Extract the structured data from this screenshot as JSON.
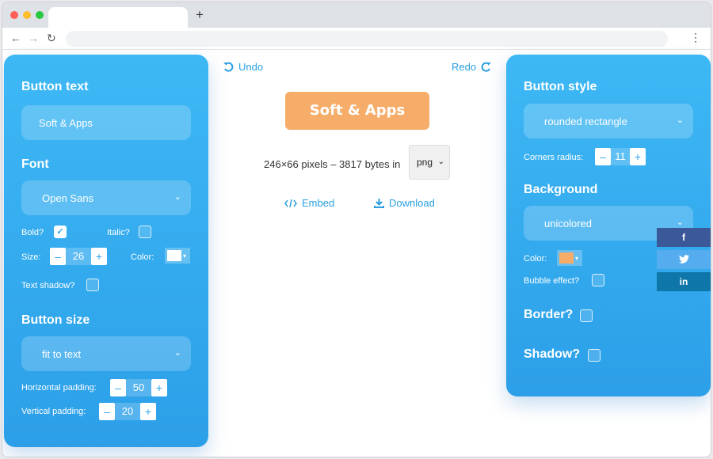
{
  "browser": {
    "new_tab": "+",
    "back": "←",
    "forward": "→",
    "reload": "↻",
    "menu": "⋮"
  },
  "center": {
    "undo": "Undo",
    "redo": "Redo",
    "preview_text": "Soft & Apps",
    "info": "246×66 pixels – 3817 bytes in",
    "format": "png",
    "embed": "Embed",
    "download": "Download",
    "preview_color": "#f7ad6a"
  },
  "left": {
    "button_text_heading": "Button text",
    "button_text_value": "Soft & Apps",
    "font_heading": "Font",
    "font_value": "Open Sans",
    "bold_label": "Bold?",
    "bold_checked": true,
    "italic_label": "Italic?",
    "size_label": "Size:",
    "size_value": "26",
    "color_label": "Color:",
    "text_color": "#ffffff",
    "text_shadow_label": "Text shadow?",
    "button_size_heading": "Button size",
    "size_mode_value": "fit to text",
    "hpad_label": "Horizontal padding:",
    "hpad_value": "50",
    "vpad_label": "Vertical padding:",
    "vpad_value": "20"
  },
  "right": {
    "style_heading": "Button style",
    "style_value": "rounded rectangle",
    "corners_label": "Corners radius:",
    "corners_value": "11",
    "background_heading": "Background",
    "background_value": "unicolored",
    "color_label": "Color:",
    "bg_color": "#f7ad6a",
    "bubble_label": "Bubble effect?",
    "border_label": "Border?",
    "shadow_label": "Shadow?"
  },
  "social": {
    "facebook": "f",
    "twitter": "🐦",
    "linkedin": "in",
    "facebook_color": "#3b5998",
    "twitter_color": "#55acee",
    "linkedin_color": "#0e76a8"
  },
  "stepper": {
    "minus": "–",
    "plus": "+"
  },
  "icons": {
    "chevron": "⌄",
    "check": "✓",
    "swatch_arrow": "▾"
  }
}
